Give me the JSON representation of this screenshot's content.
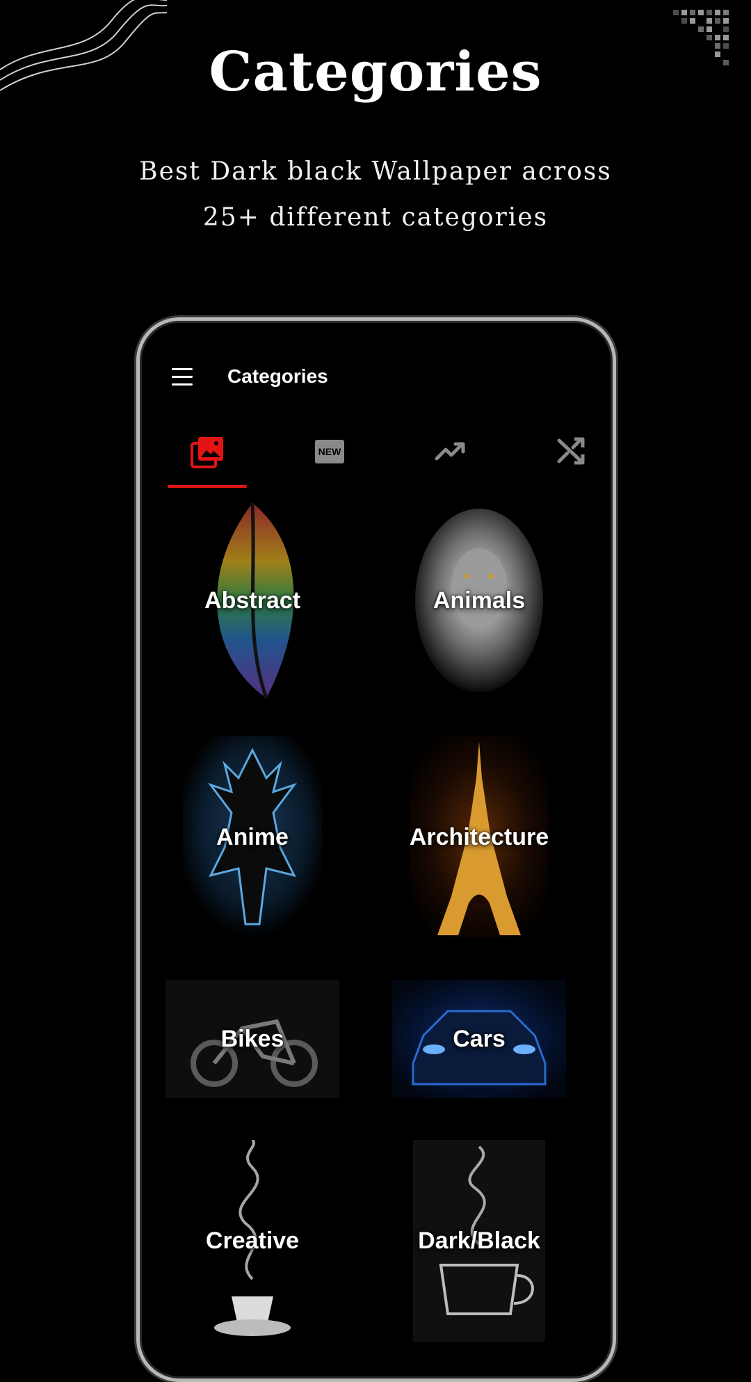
{
  "hero": {
    "title": "Categories",
    "subtitle_line1": "Best Dark black Wallpaper across",
    "subtitle_line2": "25+ different categories"
  },
  "app": {
    "title": "Categories",
    "menu_icon": "hamburger-menu-icon",
    "tabs": [
      {
        "icon": "gallery-icon",
        "selected": true
      },
      {
        "icon": "new-badge-icon",
        "label": "NEW",
        "selected": false
      },
      {
        "icon": "trending-icon",
        "selected": false
      },
      {
        "icon": "shuffle-icon",
        "selected": false
      }
    ],
    "categories": [
      {
        "label": "Abstract"
      },
      {
        "label": "Animals"
      },
      {
        "label": "Anime"
      },
      {
        "label": "Architecture"
      },
      {
        "label": "Bikes"
      },
      {
        "label": "Cars"
      },
      {
        "label": "Creative"
      },
      {
        "label": "Dark/Black"
      }
    ]
  },
  "colors": {
    "background": "#000000",
    "accent": "#e31414",
    "inactive_icon": "#8a8a8a",
    "frame": "#b8b8b8"
  }
}
